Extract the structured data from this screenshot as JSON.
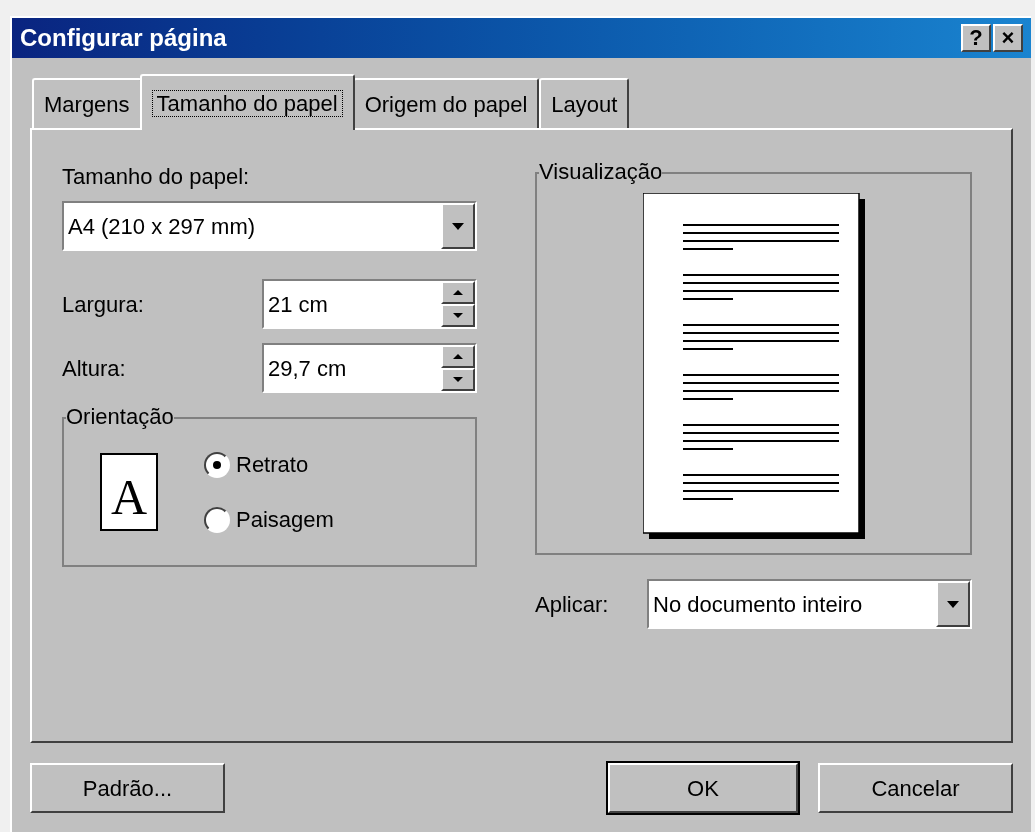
{
  "window": {
    "title": "Configurar página",
    "title_buttons": [
      "?",
      "×"
    ]
  },
  "tabs": [
    {
      "label": "Margens",
      "selected": false
    },
    {
      "label": "Tamanho do papel",
      "selected": true
    },
    {
      "label": "Origem do papel",
      "selected": false
    },
    {
      "label": "Layout",
      "selected": false
    }
  ],
  "paper_size": {
    "label": "Tamanho do papel:",
    "value": "A4 (210 x 297 mm)"
  },
  "width": {
    "label": "Largura:",
    "value": "21 cm"
  },
  "height": {
    "label": "Altura:",
    "value": "29,7 cm"
  },
  "orientation": {
    "title": "Orientação",
    "icon_letter": "A",
    "options": [
      {
        "label": "Retrato",
        "selected": true
      },
      {
        "label": "Paisagem",
        "selected": false
      }
    ]
  },
  "preview": {
    "title": "Visualização"
  },
  "apply": {
    "label": "Aplicar:",
    "value": "No documento inteiro"
  },
  "buttons": [
    {
      "label": "Padrão...",
      "kind": "left"
    },
    {
      "label": "OK",
      "kind": "default"
    },
    {
      "label": "Cancelar",
      "kind": "normal"
    }
  ]
}
